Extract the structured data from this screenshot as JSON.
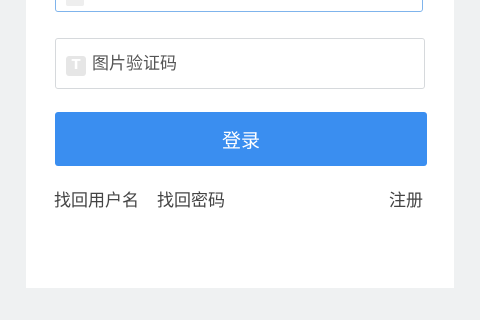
{
  "login_form": {
    "captcha": {
      "icon_letter": "T",
      "placeholder": "图片验证码",
      "value": ""
    },
    "login_button_label": "登录",
    "links": {
      "retrieve_username": "找回用户名",
      "retrieve_password": "找回密码",
      "register": "注册"
    }
  },
  "colors": {
    "primary_button": "#3a8ef0",
    "focused_border": "#7fb4ec",
    "page_background": "#eff1f2"
  }
}
